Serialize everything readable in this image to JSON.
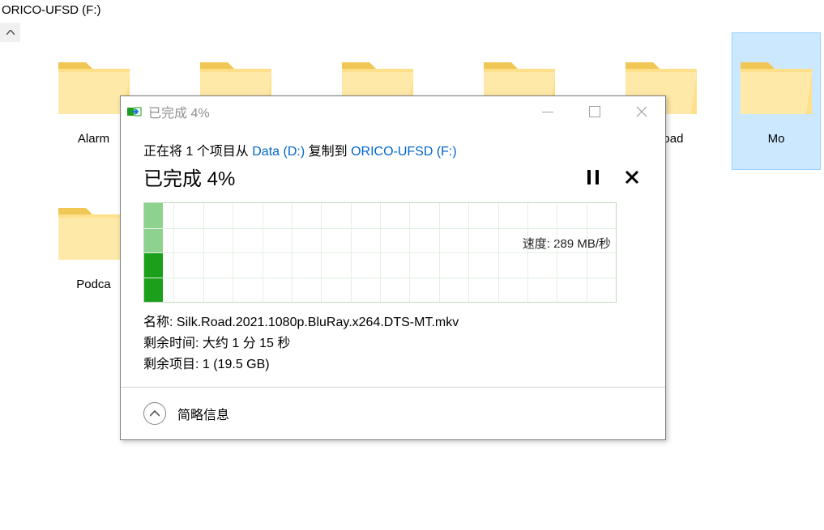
{
  "explorer": {
    "path_label": "ORICO-UFSD (F:)",
    "folders_row1": [
      {
        "label": "Alarm",
        "selected": false
      },
      {
        "label": "",
        "selected": false
      },
      {
        "label": "",
        "selected": false
      },
      {
        "label": "",
        "selected": false
      },
      {
        "label": "ownload",
        "selected": false
      },
      {
        "label": "Mo",
        "selected": true
      }
    ],
    "folders_row2": [
      {
        "label": "Podca",
        "selected": false
      }
    ]
  },
  "dialog": {
    "title": "已完成 4%",
    "headline": "已完成 4%",
    "copying": {
      "prefix": "正在将 1 个项目从 ",
      "src": "Data (D:)",
      "middle": " 复制到 ",
      "dst": "ORICO-UFSD (F:)"
    },
    "progress_percent": 4,
    "graph": {
      "speed_label": "速度: 289 MB/秒"
    },
    "details": {
      "name_key": "名称:",
      "name_val": "Silk.Road.2021.1080p.BluRay.x264.DTS-MT.mkv",
      "time_key": "剩余时间:",
      "time_val": "大约 1 分 15 秒",
      "items_key": "剩余项目:",
      "items_val": "1 (19.5 GB)"
    },
    "footer": "简略信息"
  }
}
